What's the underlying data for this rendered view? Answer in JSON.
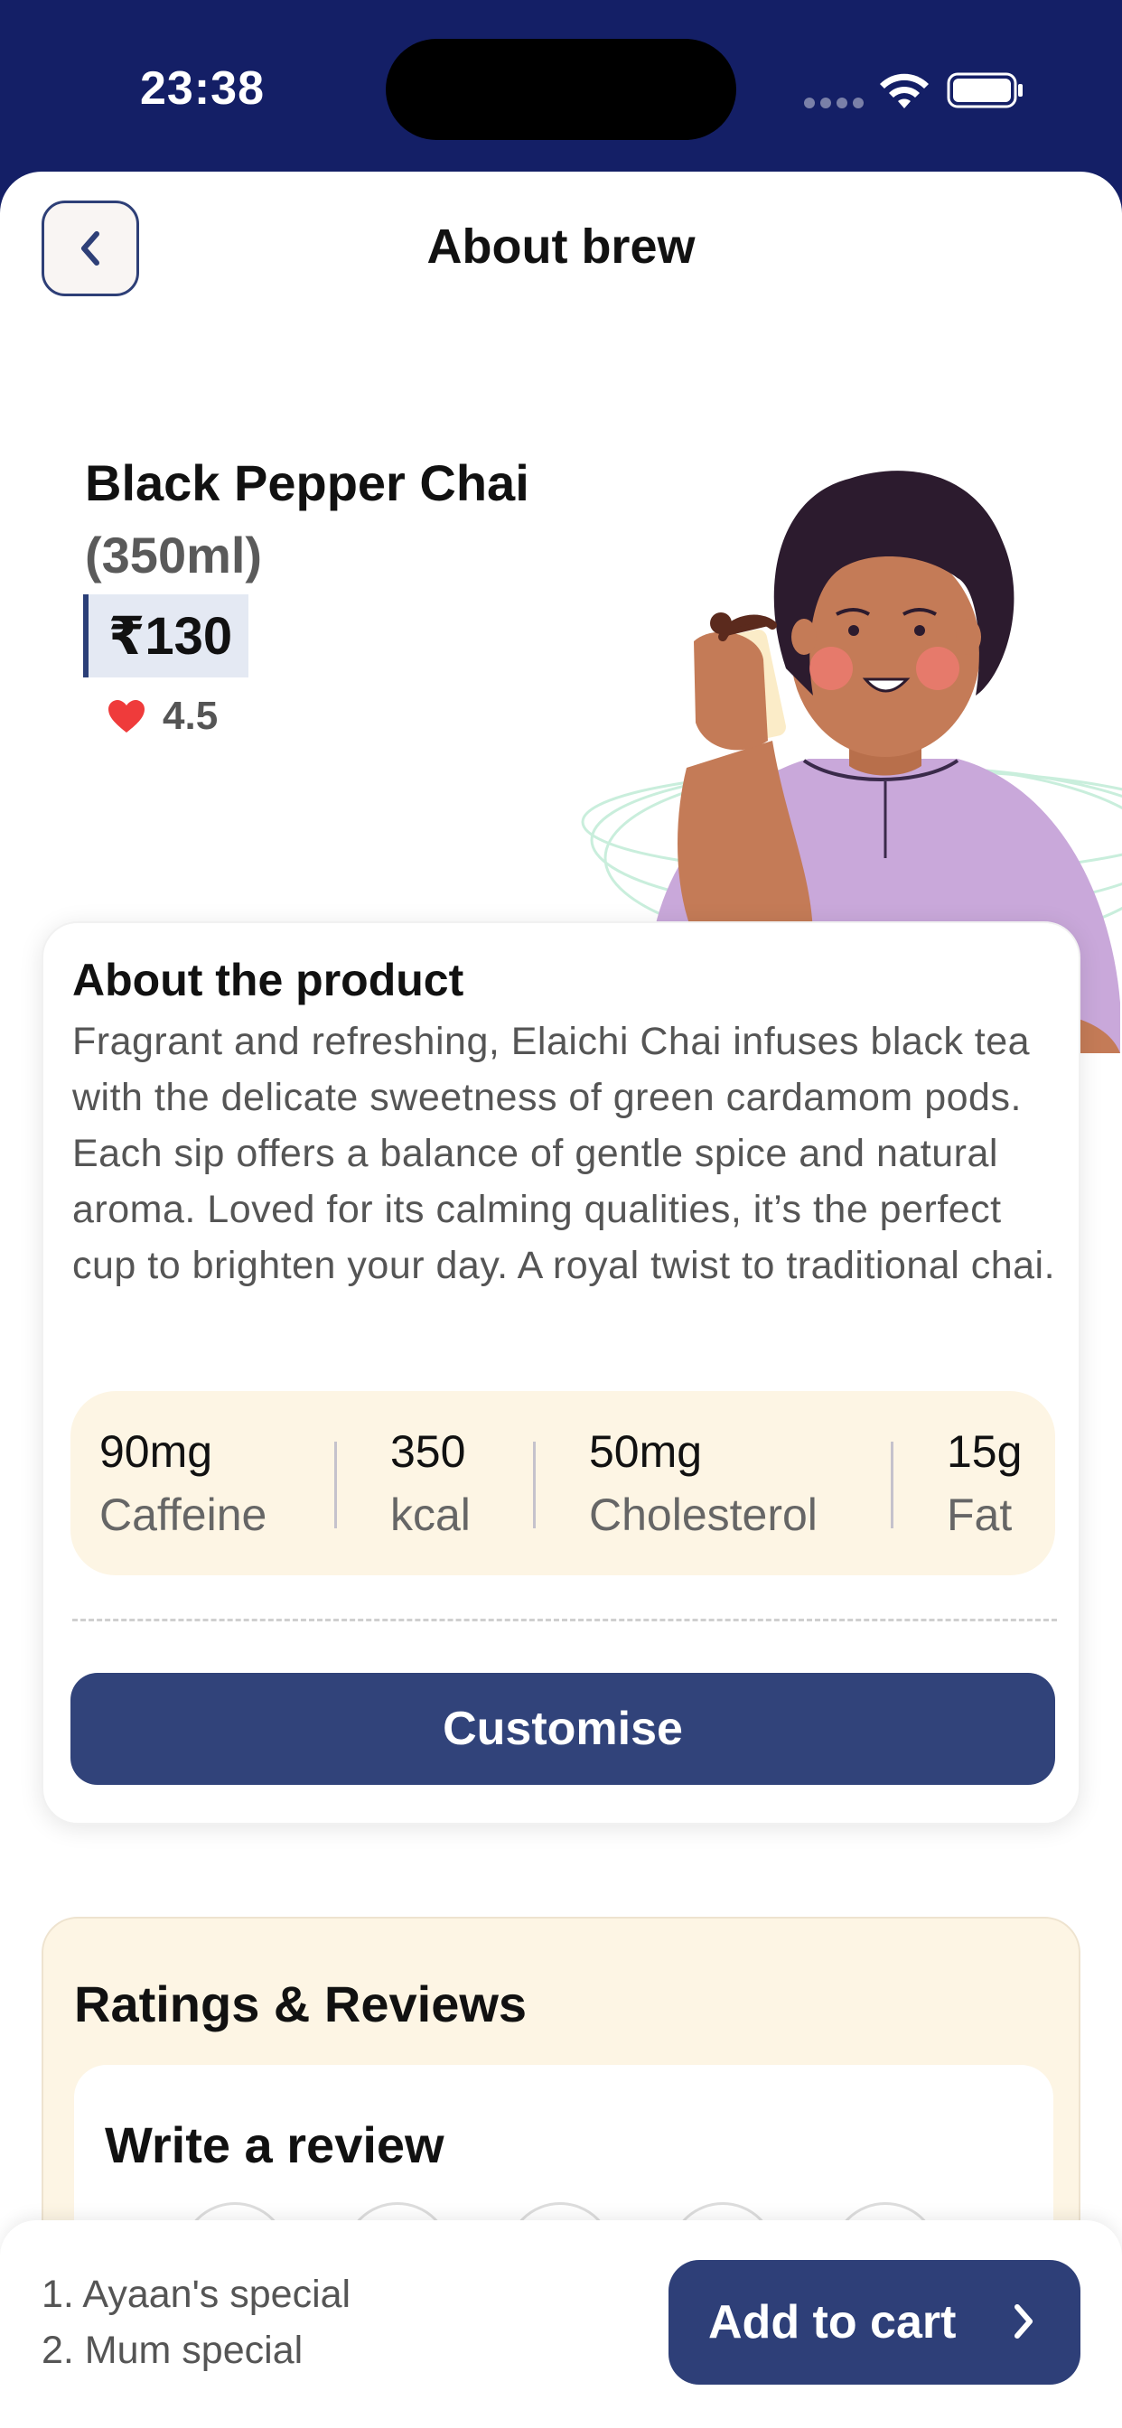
{
  "status_bar": {
    "time": "23:38"
  },
  "header": {
    "title": "About brew"
  },
  "product": {
    "name": "Black Pepper Chai",
    "size": "(350ml)",
    "price": "₹130",
    "rating": "4.5"
  },
  "about": {
    "title": "About the product",
    "description": "Fragrant and refreshing, Elaichi Chai infuses black tea with the delicate sweetness of green cardamom pods. Each sip offers a balance of gentle spice and natural aroma. Loved for its calming qualities, it’s the perfect cup to brighten your day. A royal twist to traditional chai."
  },
  "nutrition": [
    {
      "value": "90mg",
      "label": "Caffeine"
    },
    {
      "value": "350",
      "label": "kcal"
    },
    {
      "value": "50mg",
      "label": "Cholesterol"
    },
    {
      "value": "15g",
      "label": "Fat"
    }
  ],
  "customise_label": "Customise",
  "reviews": {
    "title": "Ratings & Reviews",
    "write_title": "Write a review"
  },
  "bottom": {
    "specials": [
      "1. Ayaan's special",
      "2. Mum special"
    ],
    "add_to_cart": "Add to cart"
  },
  "colors": {
    "navy": "#141f66",
    "primary_button": "#31437a",
    "nutrition_bg": "#fdf5e4",
    "heart": "#ef3b3b"
  }
}
